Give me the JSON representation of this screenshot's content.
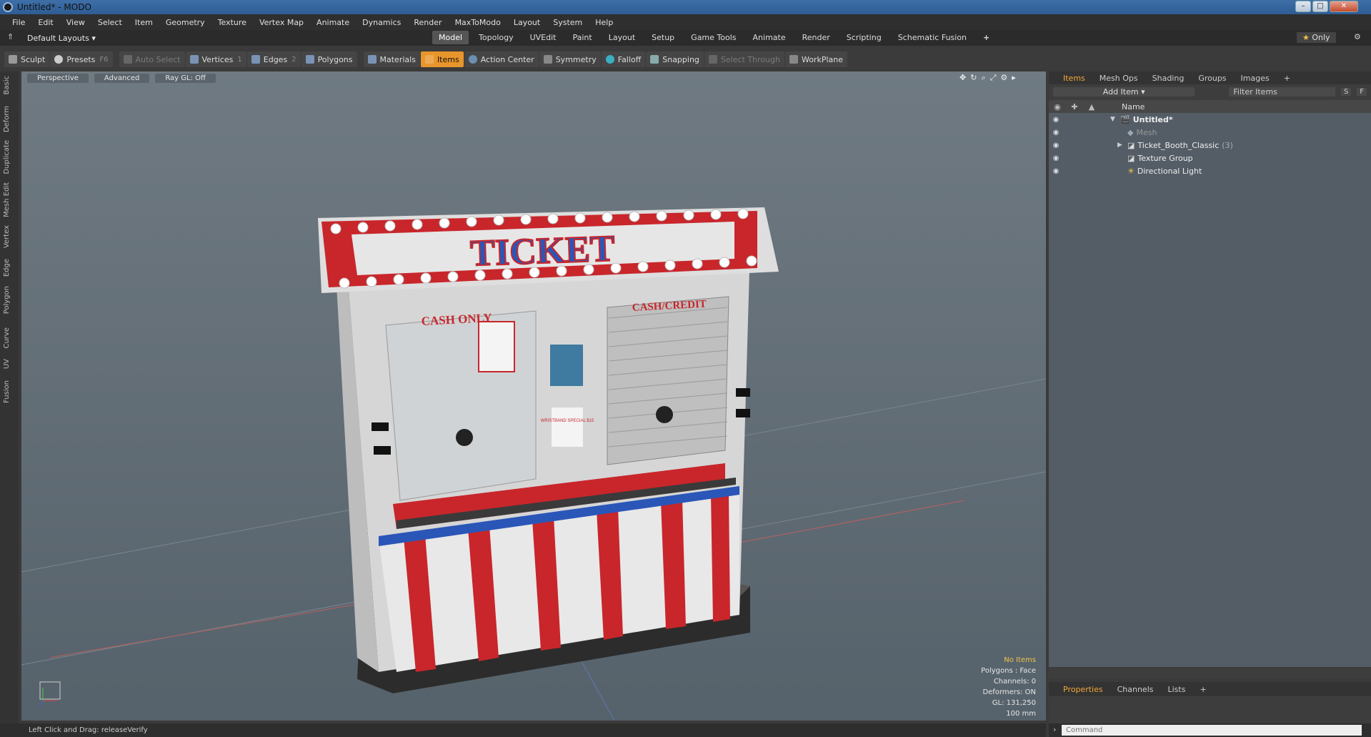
{
  "window": {
    "title": "Untitled* - MODO"
  },
  "menu": [
    "File",
    "Edit",
    "View",
    "Select",
    "Item",
    "Geometry",
    "Texture",
    "Vertex Map",
    "Animate",
    "Dynamics",
    "Render",
    "MaxToModo",
    "Layout",
    "System",
    "Help"
  ],
  "layout": {
    "default_layouts": "Default Layouts",
    "tabs": [
      "Model",
      "Topology",
      "UVEdit",
      "Paint",
      "Layout",
      "Setup",
      "Game Tools",
      "Animate",
      "Render",
      "Scripting",
      "Schematic Fusion"
    ],
    "active_tab": "Model",
    "add": "+",
    "only": "Only"
  },
  "toolbar": {
    "sculpt": "Sculpt",
    "presets": "Presets",
    "presets_key": "F6",
    "auto_select": "Auto Select",
    "vertices": "Vertices",
    "vertices_key": "1",
    "edges": "Edges",
    "edges_key": "2",
    "polygons": "Polygons",
    "materials": "Materials",
    "items": "Items",
    "action_center": "Action Center",
    "symmetry": "Symmetry",
    "falloff": "Falloff",
    "snapping": "Snapping",
    "select_through": "Select Through",
    "workplane": "WorkPlane"
  },
  "left_tabs": [
    "Basic",
    "Deform",
    "Duplicate",
    "Mesh Edit",
    "Vertex",
    "Edge",
    "Polygon",
    "Curve",
    "UV",
    "Fusion"
  ],
  "viewport": {
    "view": "Perspective",
    "mode": "Advanced",
    "raygl": "Ray GL: Off",
    "model_labels": {
      "sign": "TICKET",
      "left_sign": "CASH ONLY",
      "right_sign": "CASH/CREDIT",
      "poster": "WRISTBAND SPECIAL $15"
    },
    "stats": {
      "selection": "No Items",
      "polygons": "Polygons : Face",
      "channels": "Channels: 0",
      "deformers": "Deformers: ON",
      "gl": "GL: 131,250",
      "scale": "100 mm"
    }
  },
  "panel": {
    "tabs": [
      "Items",
      "Mesh Ops",
      "Shading",
      "Groups",
      "Images"
    ],
    "active_tab": "Items",
    "add_item": "Add Item",
    "filter_placeholder": "Filter Items",
    "s_btn": "S",
    "f_btn": "F",
    "name_header": "Name",
    "items": [
      {
        "label": "Untitled*",
        "count": ""
      },
      {
        "label": "Mesh",
        "count": ""
      },
      {
        "label": "Ticket_Booth_Classic",
        "count": "(3)"
      },
      {
        "label": "Texture Group",
        "count": ""
      },
      {
        "label": "Directional Light",
        "count": ""
      }
    ]
  },
  "props": {
    "tabs": [
      "Properties",
      "Channels",
      "Lists"
    ],
    "active_tab": "Properties"
  },
  "status": {
    "text": "Left Click and Drag:  releaseVerify"
  },
  "command": {
    "placeholder": "Command"
  },
  "colors": {
    "accent": "#e8952b",
    "booth_red": "#c8262b",
    "booth_blue": "#2a56b8",
    "viewport_bg": "#66727b"
  }
}
